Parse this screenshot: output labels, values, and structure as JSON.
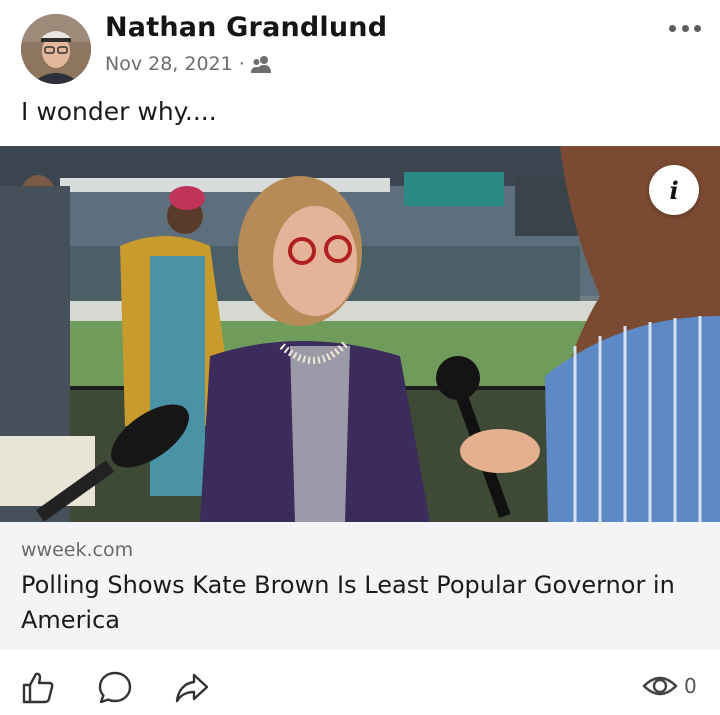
{
  "post": {
    "author_name": "Nathan Grandlund",
    "date": "Nov 28, 2021",
    "separator": "·",
    "audience_icon": "friends-icon",
    "text": "I wonder why...."
  },
  "link": {
    "domain": "wweek.com",
    "title": "Polling Shows Kate Brown Is Least Popular Governor in America",
    "info_label": "i"
  },
  "actions": {
    "like_icon": "thumbs-up-icon",
    "comment_icon": "comment-icon",
    "share_icon": "share-icon",
    "views_icon": "eye-icon",
    "view_count": "0"
  },
  "colors": {
    "text": "#1c1c1c",
    "meta": "#6d6d6d",
    "card_bg": "#f4f4f6"
  }
}
